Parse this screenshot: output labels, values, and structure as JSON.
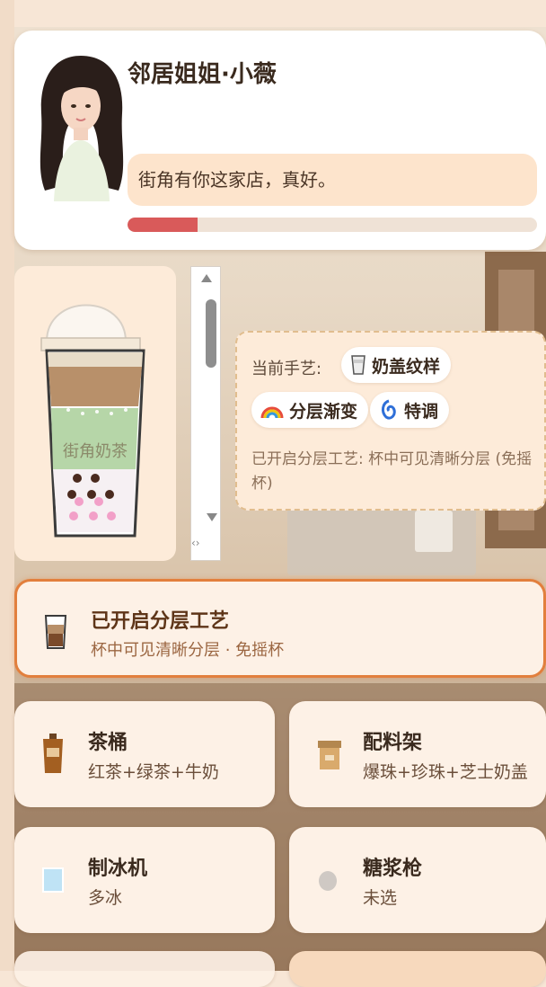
{
  "character": {
    "name": "邻居姐姐·小薇",
    "dialogue": "街角有你这家店，真好。",
    "favor": 0.17
  },
  "cup": {
    "label": "街角奶茶"
  },
  "craft": {
    "title": "当前手艺:",
    "chips": [
      {
        "label": "奶盖纹样",
        "icon": "cup-icon"
      },
      {
        "label": "分层渐变",
        "icon": "rainbow-icon"
      },
      {
        "label": "特调",
        "icon": "swirl-icon"
      }
    ],
    "description": "已开启分层工艺: 杯中可见清晰分层 (免摇杯)"
  },
  "layer_status": {
    "title": "已开启分层工艺",
    "subtitle": "杯中可见清晰分层 · 免摇杯"
  },
  "stations": [
    {
      "title": "茶桶",
      "subtitle": "红茶+绿茶+牛奶",
      "icon": "tea-bucket-icon"
    },
    {
      "title": "配料架",
      "subtitle": "爆珠+珍珠+芝士奶盖",
      "icon": "topping-box-icon"
    },
    {
      "title": "制冰机",
      "subtitle": "多冰",
      "icon": "ice-cube-icon"
    },
    {
      "title": "糖浆枪",
      "subtitle": "未选",
      "icon": "syrup-dot-icon"
    }
  ],
  "colors": {
    "accent": "#e27f3d",
    "favor_bar": "#d95a5a",
    "card_bg": "#fdf1e6"
  }
}
